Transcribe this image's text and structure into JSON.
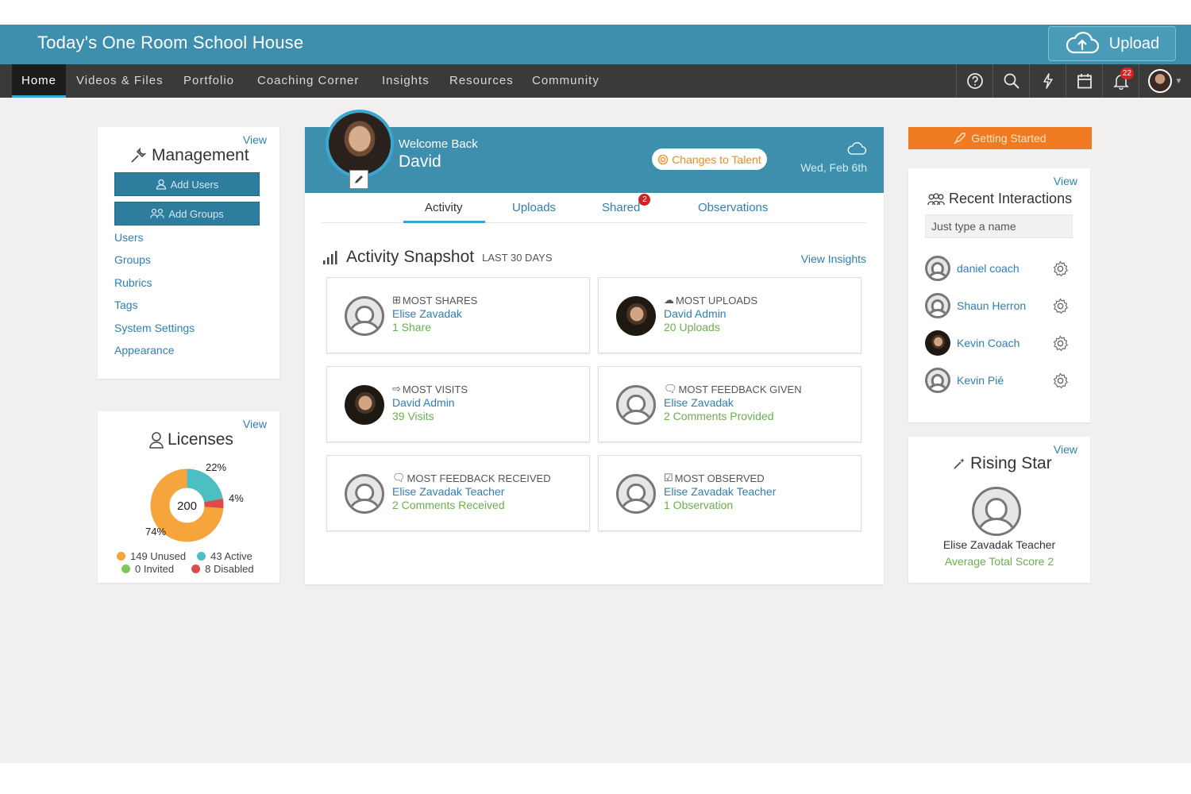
{
  "header": {
    "app_title": "Today's One Room School House",
    "upload_label": "Upload"
  },
  "nav": {
    "items": [
      {
        "label": "Home",
        "active": true
      },
      {
        "label": "Videos & Files"
      },
      {
        "label": "Portfolio"
      },
      {
        "label": "Coaching Corner"
      },
      {
        "label": "Insights"
      },
      {
        "label": "Resources"
      },
      {
        "label": "Community"
      }
    ],
    "icons": [
      "help-icon",
      "search-icon",
      "bolt-icon",
      "calendar-icon",
      "bell-icon",
      "avatar"
    ],
    "notification_count": "22"
  },
  "management": {
    "view_label": "View",
    "title": "Management",
    "add_users_label": "Add Users",
    "add_groups_label": "Add Groups",
    "links": [
      "Users",
      "Groups",
      "Rubrics",
      "Tags",
      "System Settings",
      "Appearance"
    ]
  },
  "licenses": {
    "view_label": "View",
    "title": "Licenses",
    "total": "200",
    "pct_active": "22%",
    "pct_disabled": "4%",
    "pct_unused": "74%",
    "legend": {
      "unused": "149 Unused",
      "active": "43 Active",
      "invited": "0 Invited",
      "disabled": "8 Disabled"
    },
    "colors": {
      "unused": "#f5a53b",
      "active": "#4bbfc2",
      "invited": "#7cc85a",
      "disabled": "#e04a4a"
    }
  },
  "welcome": {
    "greeting": "Welcome Back",
    "name": "David",
    "talent_label": "Changes to Talent",
    "date": "Wed, Feb 6th"
  },
  "tabs": {
    "activity": "Activity",
    "uploads": "Uploads",
    "shared": "Shared",
    "shared_badge": "2",
    "observations": "Observations"
  },
  "snapshot": {
    "title": "Activity Snapshot",
    "subtitle": "LAST 30 DAYS",
    "view_insights": "View Insights",
    "stats": [
      {
        "label": "MOST SHARES",
        "icon": "share-icon",
        "name": "Elise Zavadak",
        "value": "1 Share",
        "avatar": "generic"
      },
      {
        "label": "MOST UPLOADS",
        "icon": "upload-icon",
        "name": "David Admin",
        "value": "20 Uploads",
        "avatar": "photo"
      },
      {
        "label": "MOST VISITS",
        "icon": "visit-icon",
        "name": "David Admin",
        "value": "39 Visits",
        "avatar": "photo"
      },
      {
        "label": "MOST FEEDBACK GIVEN",
        "icon": "chat-icon",
        "name": "Elise Zavadak",
        "value": "2 Comments Provided",
        "avatar": "generic"
      },
      {
        "label": "MOST FEEDBACK RECEIVED",
        "icon": "chat-icon",
        "name": "Elise Zavadak Teacher",
        "value": "2 Comments Received",
        "avatar": "generic"
      },
      {
        "label": "MOST OBSERVED",
        "icon": "check-icon",
        "name": "Elise Zavadak Teacher",
        "value": "1 Observation",
        "avatar": "generic"
      }
    ]
  },
  "getting_started": {
    "label": "Getting Started"
  },
  "recent": {
    "view_label": "View",
    "title": "Recent Interactions",
    "search_placeholder": "Just type a name",
    "people": [
      {
        "name": "daniel coach",
        "avatar": "generic"
      },
      {
        "name": "Shaun Herron",
        "avatar": "generic"
      },
      {
        "name": "Kevin Coach",
        "avatar": "photo"
      },
      {
        "name": "Kevin Pié",
        "avatar": "generic"
      }
    ]
  },
  "rising_star": {
    "view_label": "View",
    "title": "Rising Star",
    "name": "Elise Zavadak Teacher",
    "score": "Average Total Score 2"
  }
}
